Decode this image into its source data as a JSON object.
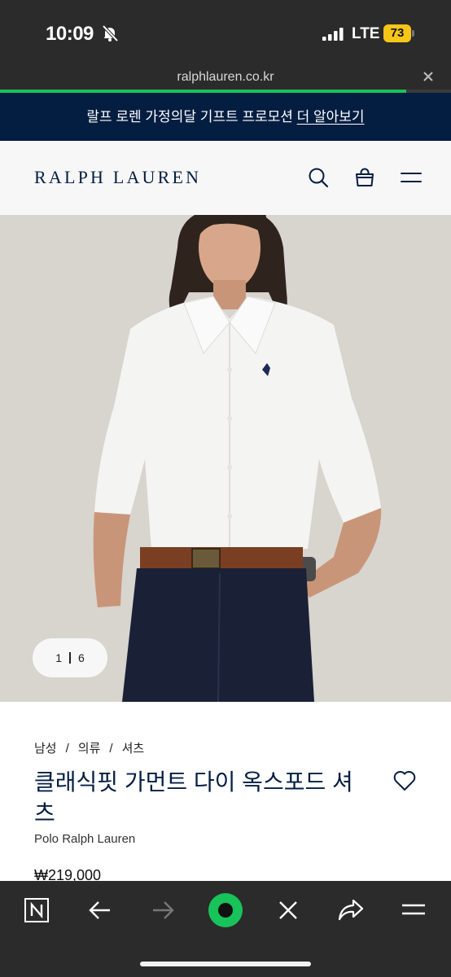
{
  "status": {
    "time": "10:09",
    "network": "LTE",
    "battery": "73"
  },
  "browser": {
    "url": "ralphlauren.co.kr",
    "load_progress_percent": 90
  },
  "promo": {
    "text": "랄프 로렌 가정의달 기프트 프로모션",
    "link": "더 알아보기"
  },
  "header": {
    "logo": "RALPH LAUREN",
    "icons": [
      "search-icon",
      "shopping-bag-icon",
      "menu-icon"
    ]
  },
  "gallery": {
    "current": "1",
    "total": "6"
  },
  "product": {
    "breadcrumb": [
      "남성",
      "의류",
      "셔츠"
    ],
    "title": "클래식핏 가먼트 다이 옥스포드 셔츠",
    "brand": "Polo Ralph Lauren",
    "price": "₩219,000"
  },
  "toolbar": {
    "icons": [
      "naver-n-icon",
      "back-arrow-icon",
      "forward-arrow-icon",
      "naver-green-dot-icon",
      "close-x-icon",
      "share-arrow-icon",
      "hamburger-menu-icon"
    ]
  },
  "colors": {
    "navy": "#041e42",
    "green": "#18c35a",
    "battery": "#f5c518",
    "chrome": "#2b2b2b"
  }
}
